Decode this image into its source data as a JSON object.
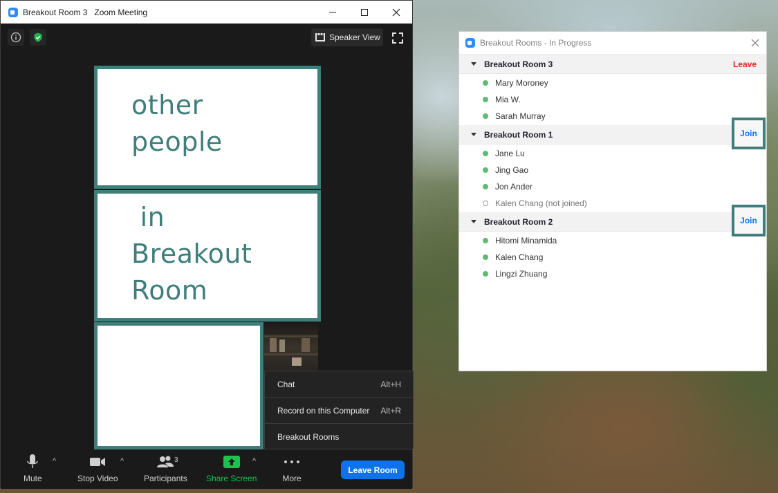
{
  "meeting_window": {
    "title": "Breakout Room 3   Zoom Meeting",
    "speaker_view_label": "Speaker View",
    "panels": {
      "top_text": "other\npeople",
      "middle_text": " in\nBreakout\nRoom"
    },
    "context_menu": [
      {
        "label": "Chat",
        "shortcut": "Alt+H"
      },
      {
        "label": "Record on this Computer",
        "shortcut": "Alt+R"
      },
      {
        "label": "Breakout Rooms",
        "shortcut": ""
      }
    ],
    "toolbar": {
      "mute": "Mute",
      "stop_video": "Stop Video",
      "participants": "Participants",
      "participant_count": "3",
      "share_screen": "Share Screen",
      "more": "More",
      "leave_room": "Leave Room"
    }
  },
  "breakout_window": {
    "title": "Breakout Rooms - In Progress",
    "rooms": [
      {
        "name": "Breakout Room 3",
        "action": "Leave",
        "participants": [
          {
            "name": "Mary Moroney",
            "joined": true
          },
          {
            "name": "Mia W.",
            "joined": true
          },
          {
            "name": "Sarah Murray",
            "joined": true
          }
        ]
      },
      {
        "name": "Breakout Room 1",
        "action": "Join",
        "participants": [
          {
            "name": "Jane Lu",
            "joined": true
          },
          {
            "name": "Jing Gao",
            "joined": true
          },
          {
            "name": "Jon Ander",
            "joined": true
          },
          {
            "name": "Kalen Chang (not joined)",
            "joined": false
          }
        ]
      },
      {
        "name": "Breakout Room 2",
        "action": "Join",
        "participants": [
          {
            "name": "Hitomi Minamida",
            "joined": true
          },
          {
            "name": "Kalen Chang",
            "joined": true
          },
          {
            "name": "Lingzi Zhuang",
            "joined": true
          }
        ]
      }
    ]
  },
  "colors": {
    "accent_teal": "#3f7e7a",
    "zoom_blue": "#0e72ed",
    "leave_red": "#e02828",
    "share_green": "#1bc24d",
    "online_green": "#5fbb73"
  }
}
